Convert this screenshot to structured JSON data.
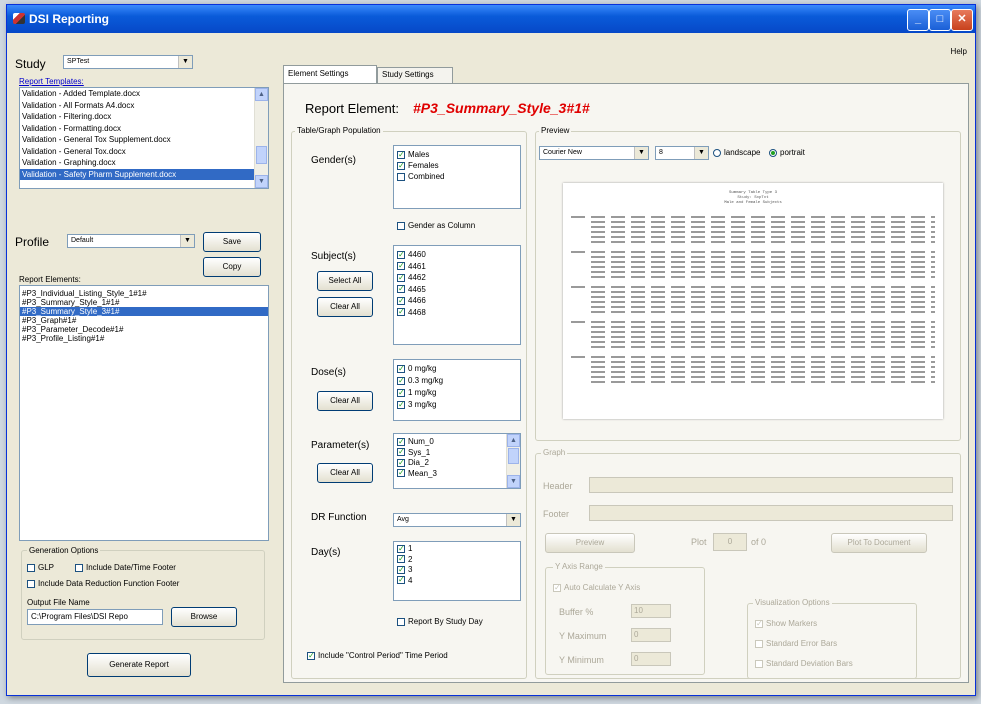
{
  "window": {
    "title": "DSI Reporting",
    "help_menu": "Help"
  },
  "left": {
    "study_label": "Study",
    "study_value": "SPTest",
    "report_templates_label": "Report Templates:",
    "templates": [
      "Validation - Added Template.docx",
      "Validation - All Formats A4.docx",
      "Validation - Filtering.docx",
      "Validation - Formatting.docx",
      "Validation - General Tox Supplement.docx",
      "Validation - General Tox.docx",
      "Validation - Graphing.docx",
      "Validation - Safety Pharm Supplement.docx"
    ],
    "profile_label": "Profile",
    "profile_value": "Default",
    "save_label": "Save",
    "copy_label": "Copy",
    "report_elements_label": "Report Elements:",
    "elements": [
      "#P3_Individual_Listing_Style_1#1#",
      "#P3_Summary_Style_1#1#",
      "#P3_Summary_Style_3#1#",
      "#P3_Graph#1#",
      "#P3_Parameter_Decode#1#",
      "#P3_Profile_Listing#1#"
    ],
    "gen_options_title": "Generation Options",
    "glp_label": "GLP",
    "date_footer_label": "Include Date/Time Footer",
    "dr_footer_label": "Include Data Reduction Function Footer",
    "output_file_label": "Output File Name",
    "output_file_value": "C:\\Program Files\\DSI Repo",
    "browse_label": "Browse",
    "generate_label": "Generate Report"
  },
  "tabs": [
    "Element Settings",
    "Study Settings"
  ],
  "main": {
    "report_element_label": "Report Element:",
    "report_element_value": "#P3_Summary_Style_3#1#",
    "population_title": "Table/Graph Population",
    "gender_label": "Gender(s)",
    "genders": [
      {
        "label": "Males",
        "checked": true
      },
      {
        "label": "Females",
        "checked": true
      },
      {
        "label": "Combined",
        "checked": false
      }
    ],
    "gender_column_label": "Gender as Column",
    "subject_label": "Subject(s)",
    "subjects": [
      "4460",
      "4461",
      "4462",
      "4465",
      "4466",
      "4468"
    ],
    "select_all_label": "Select All",
    "clear_all_label": "Clear All",
    "dose_label": "Dose(s)",
    "doses": [
      "0 mg/kg",
      "0.3 mg/kg",
      "1 mg/kg",
      "3 mg/kg"
    ],
    "parameter_label": "Parameter(s)",
    "parameters": [
      "Num_0",
      "Sys_1",
      "Dia_2",
      "Mean_3"
    ],
    "dr_function_label": "DR Function",
    "dr_function_value": "Avg",
    "day_label": "Day(s)",
    "days": [
      "1",
      "2",
      "3",
      "4"
    ],
    "report_by_day_label": "Report By Study Day",
    "control_period_label": "Include \"Control Period\" Time Period"
  },
  "preview": {
    "title": "Preview",
    "font_value": "Courier New",
    "size_value": "8",
    "landscape_label": "landscape",
    "portrait_label": "portrait"
  },
  "graph": {
    "title": "Graph",
    "header_label": "Header",
    "footer_label": "Footer",
    "preview_label": "Preview",
    "plot_label": "Plot",
    "plot_value": "0",
    "of_label": "of 0",
    "plot_to_doc_label": "Plot To Document",
    "yaxis_title": "Y Axis Range",
    "auto_calc_label": "Auto Calculate Y Axis",
    "buffer_label": "Buffer %",
    "buffer_value": "10",
    "ymax_label": "Y Maximum",
    "ymax_value": "0",
    "ymin_label": "Y Minimum",
    "ymin_value": "0",
    "vis_title": "Visualization Options",
    "show_markers_label": "Show Markers",
    "std_err_label": "Standard Error Bars",
    "std_dev_label": "Standard Deviation Bars"
  },
  "colors": {
    "selection": "#316ac5",
    "element_name": "#e00000",
    "titlebar": "#0a5bd9"
  }
}
